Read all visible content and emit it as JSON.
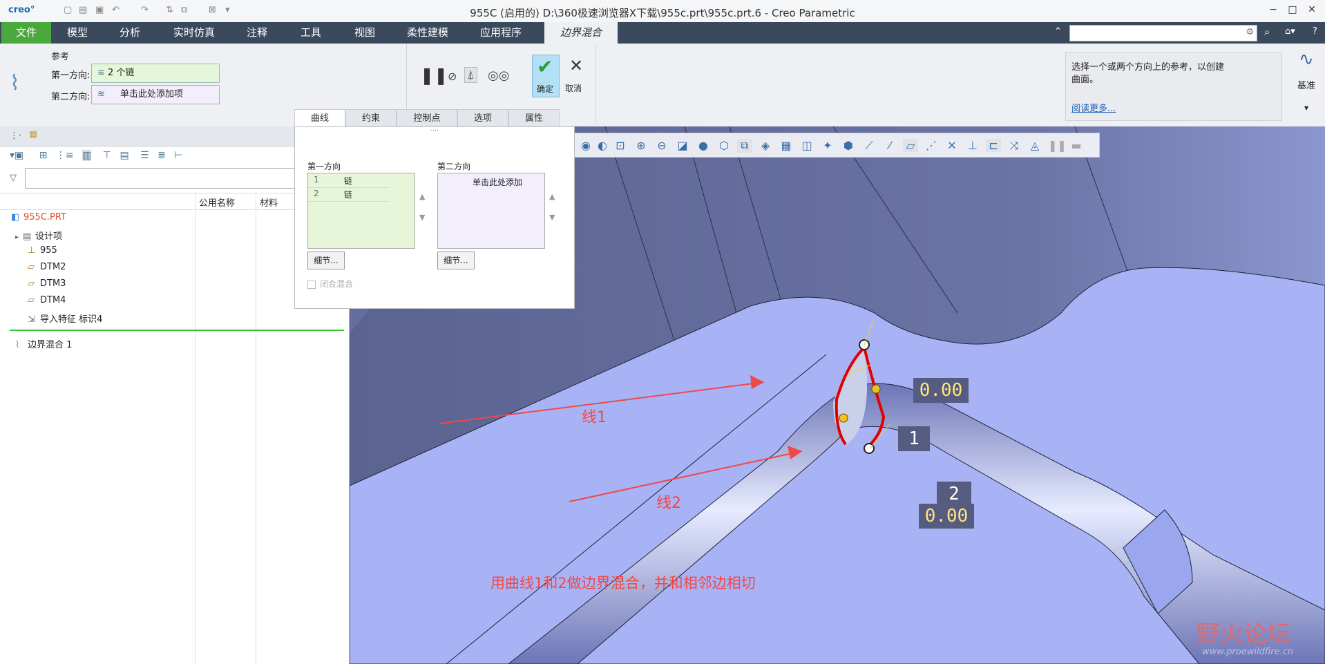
{
  "app": {
    "logo": "creo°",
    "title": "955C (启用的) D:\\360极速浏览器X下载\\955c.prt\\955c.prt.6 - Creo Parametric"
  },
  "menu": {
    "tabs": [
      "文件",
      "模型",
      "分析",
      "实时仿真",
      "注释",
      "工具",
      "视图",
      "柔性建模",
      "应用程序",
      "边界混合"
    ]
  },
  "ribbon": {
    "ref_group": "参考",
    "dir1_label": "第一方向:",
    "dir1_value": "2 个链",
    "dir2_label": "第二方向:",
    "dir2_value": "单击此处添加项",
    "ok": "确定",
    "cancel": "取消",
    "subtabs": [
      "曲线",
      "约束",
      "控制点",
      "选项",
      "属性"
    ],
    "help_text_line1": "选择一个或两个方向上的参考，以创建",
    "help_text_line2": "曲面。",
    "help_link": "阅读更多...",
    "datum": "基准"
  },
  "curve_panel": {
    "dir1_header": "第一方向",
    "dir2_header": "第二方向",
    "dir1_rows": [
      {
        "index": "1",
        "name": "链"
      },
      {
        "index": "2",
        "name": "链"
      }
    ],
    "dir2_placeholder": "单击此处添加",
    "details1": "细节...",
    "details2": "细节...",
    "closed_blend": "闭合混合"
  },
  "tree": {
    "columns": [
      "公用名称",
      "材料"
    ],
    "items": [
      {
        "label": "955C.PRT",
        "icon": "part-icon"
      },
      {
        "label": "设计项",
        "icon": "design-items-icon"
      },
      {
        "label": "955",
        "icon": "coordinate-system-icon"
      },
      {
        "label": "DTM2",
        "icon": "datum-plane-icon"
      },
      {
        "label": "DTM3",
        "icon": "datum-plane-icon"
      },
      {
        "label": "DTM4",
        "icon": "datum-plane-icon"
      },
      {
        "label": "导入特征 标识4",
        "icon": "import-feature-icon"
      },
      {
        "label": "边界混合 1",
        "icon": "boundary-blend-icon"
      }
    ]
  },
  "viewport": {
    "dim_top": "0.00",
    "dim_bottom": "0.00",
    "label_1": "1",
    "label_2": "2",
    "anno_line1": "线1",
    "anno_line2": "线2",
    "anno_caption": "用曲线1和2做边界混合，并和相邻边相切",
    "watermark_brand": "野火论坛",
    "watermark_url": "www.proewildfire.cn"
  },
  "colors": {
    "menubar": "#3a4a5c",
    "file_tab": "#4aa83c",
    "surface": "#aab4f5",
    "annotation": "#f04848"
  }
}
